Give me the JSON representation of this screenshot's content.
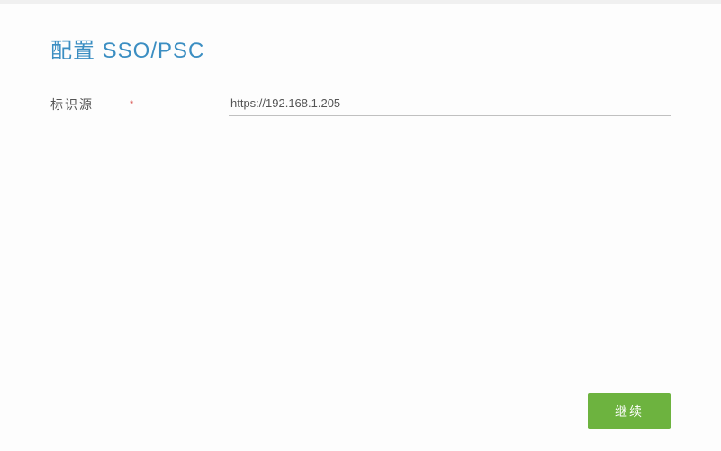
{
  "header": {
    "title": "配置 SSO/PSC"
  },
  "form": {
    "identity_source": {
      "label": "标识源",
      "required_marker": "*",
      "value": "https://192.168.1.205"
    }
  },
  "actions": {
    "continue_label": "继续"
  }
}
